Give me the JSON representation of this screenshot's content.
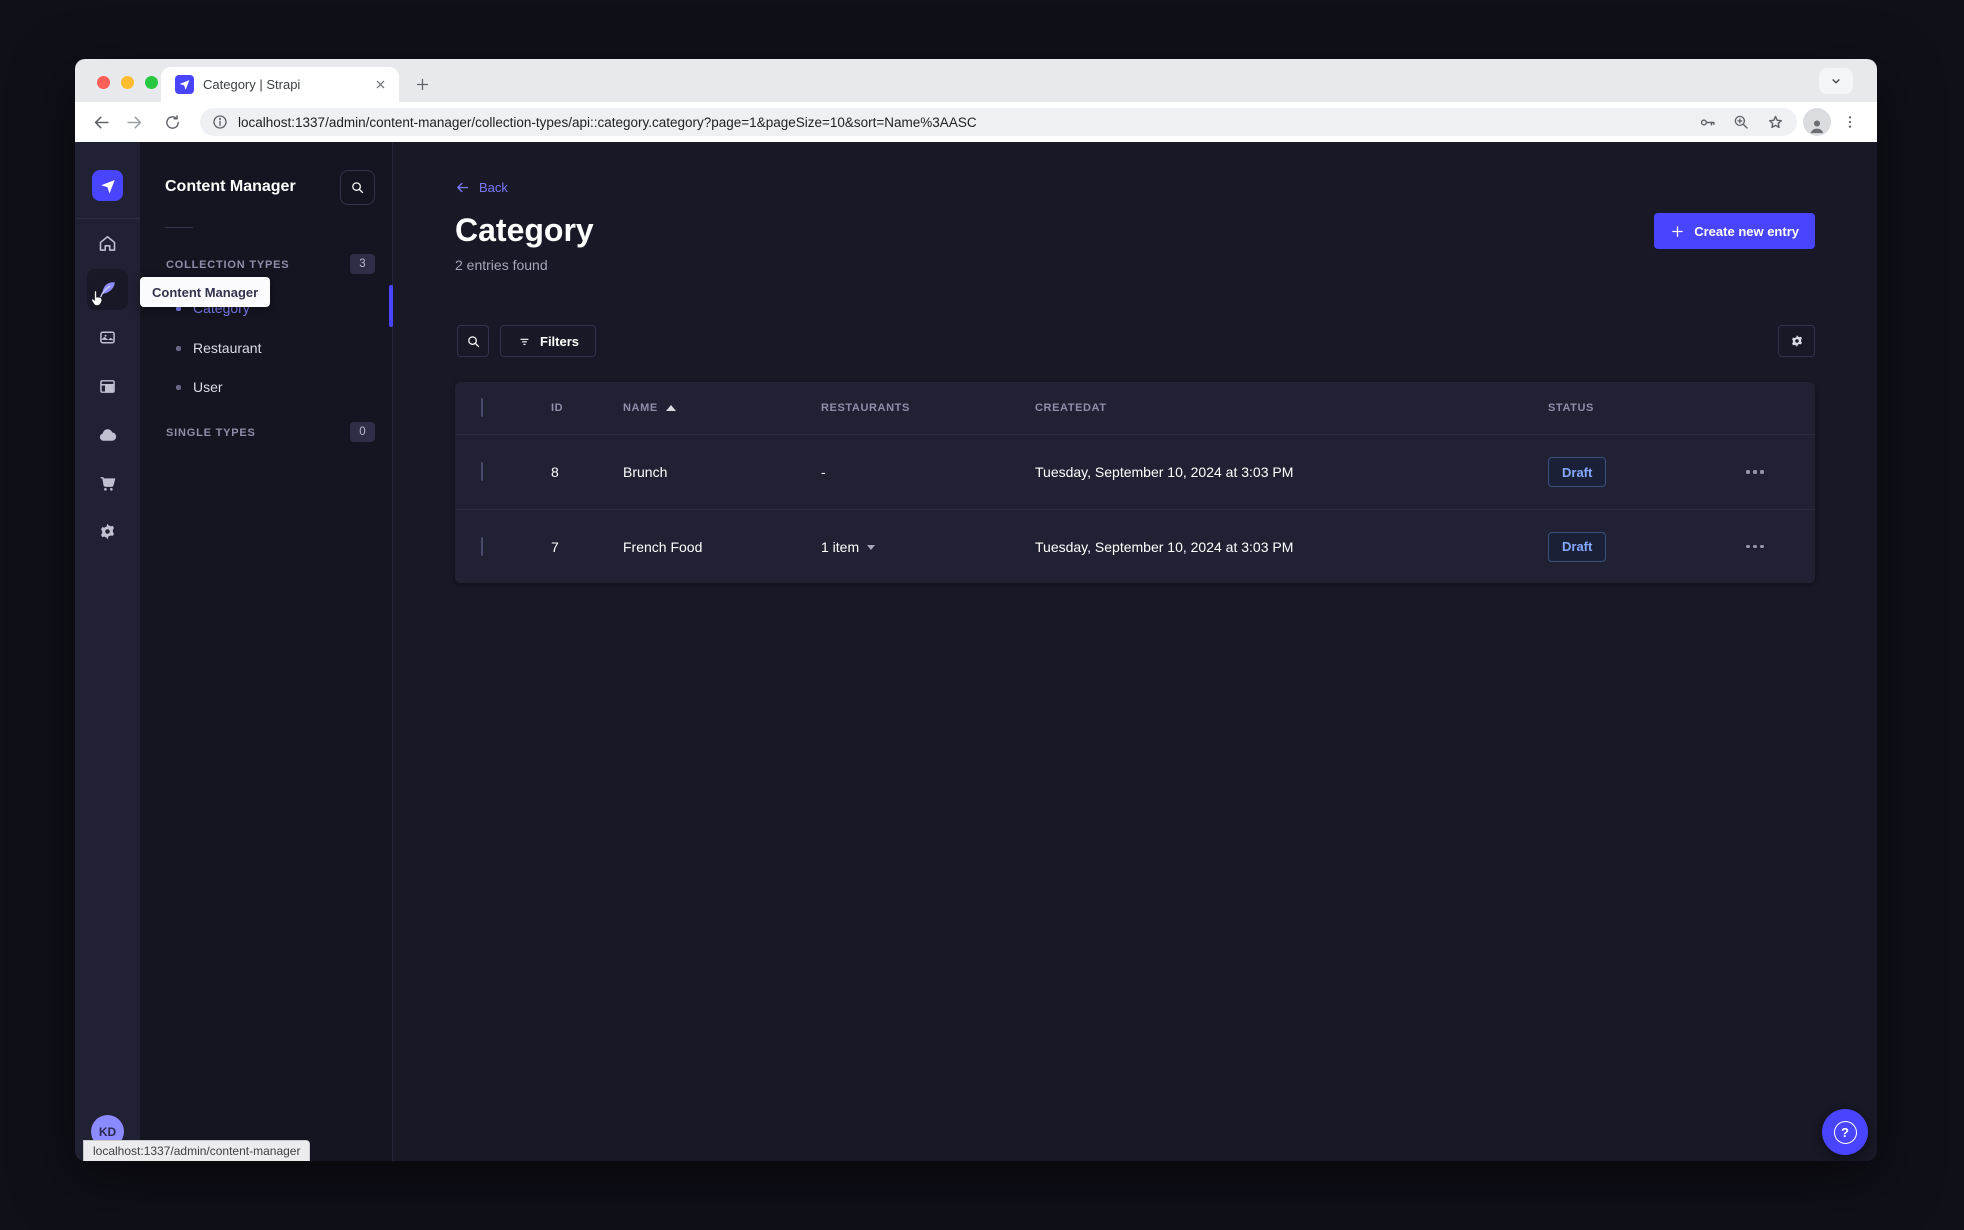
{
  "colors": {
    "primary": "#4945ff",
    "primary_text": "#7b79ff",
    "draft_text": "#84a9ff"
  },
  "browser": {
    "tab_title": "Category | Strapi",
    "url": "localhost:1337/admin/content-manager/collection-types/api::category.category?page=1&pageSize=10&sort=Name%3AASC",
    "status_bubble": "localhost:1337/admin/content-manager"
  },
  "nav": {
    "tooltip": "Content Manager",
    "user_initials": "KD",
    "help_glyph": "?"
  },
  "subnav": {
    "title": "Content Manager",
    "collection_types": {
      "label": "COLLECTION TYPES",
      "count": "3",
      "items": [
        {
          "label": "Category"
        },
        {
          "label": "Restaurant"
        },
        {
          "label": "User"
        }
      ]
    },
    "single_types": {
      "label": "SINGLE TYPES",
      "count": "0"
    }
  },
  "content": {
    "back_label": "Back",
    "title": "Category",
    "subtitle": "2 entries found",
    "create_button_label": "Create new entry",
    "filters_button_label": "Filters",
    "table": {
      "headers": {
        "id": "ID",
        "name": "NAME",
        "restaurants": "RESTAURANTS",
        "createdat": "CREATEDAT",
        "status": "STATUS"
      },
      "rows": [
        {
          "id": "8",
          "name": "Brunch",
          "restaurants": "-",
          "createdat": "Tuesday, September 10, 2024 at 3:03 PM",
          "status": "Draft"
        },
        {
          "id": "7",
          "name": "French Food",
          "restaurants": "1 item",
          "createdat": "Tuesday, September 10, 2024 at 3:03 PM",
          "status": "Draft"
        }
      ]
    }
  }
}
